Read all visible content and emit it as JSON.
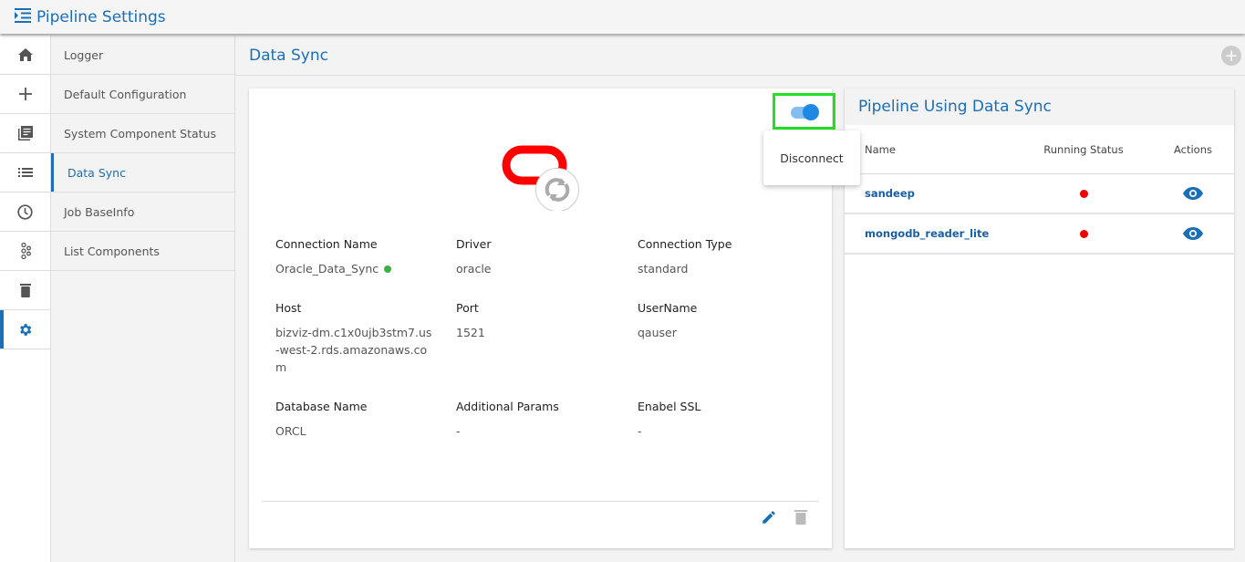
{
  "app": {
    "title": "Pipeline Settings"
  },
  "iconbar": [
    "home-icon",
    "plus-icon",
    "library-icon",
    "list-icon",
    "clock-icon",
    "kafka-icon",
    "trash-icon",
    "gear-icon"
  ],
  "submenu": [
    {
      "label": "Logger"
    },
    {
      "label": "Default Configuration"
    },
    {
      "label": "System Component Status"
    },
    {
      "label": "Data Sync"
    },
    {
      "label": "Job BaseInfo"
    },
    {
      "label": "List Components"
    }
  ],
  "page": {
    "title": "Data Sync",
    "add_label": "+"
  },
  "connection": {
    "menu_item": "Disconnect",
    "toggle_on": true,
    "fields": [
      {
        "label": "Connection Name",
        "value": "Oracle_Data_Sync"
      },
      {
        "label": "Driver",
        "value": "oracle"
      },
      {
        "label": "Connection Type",
        "value": "standard"
      },
      {
        "label": "Host",
        "value": "bizviz-dm.c1x0ujb3stm7.us-west-2.rds.amazonaws.com"
      },
      {
        "label": "Port",
        "value": "1521"
      },
      {
        "label": "UserName",
        "value": "qauser"
      },
      {
        "label": "Database Name",
        "value": "ORCL"
      },
      {
        "label": "Additional Params",
        "value": "-"
      },
      {
        "label": "Enabel SSL",
        "value": "-"
      }
    ]
  },
  "pipelines": {
    "title": "Pipeline Using Data Sync",
    "columns": [
      "Name",
      "Running Status",
      "Actions"
    ],
    "rows": [
      {
        "name": "sandeep",
        "status": "stopped"
      },
      {
        "name": "mongodb_reader_lite",
        "status": "stopped"
      }
    ]
  },
  "colors": {
    "accent": "#1a6fb5",
    "status_stopped": "#ee0000",
    "connected": "#3cb043"
  }
}
